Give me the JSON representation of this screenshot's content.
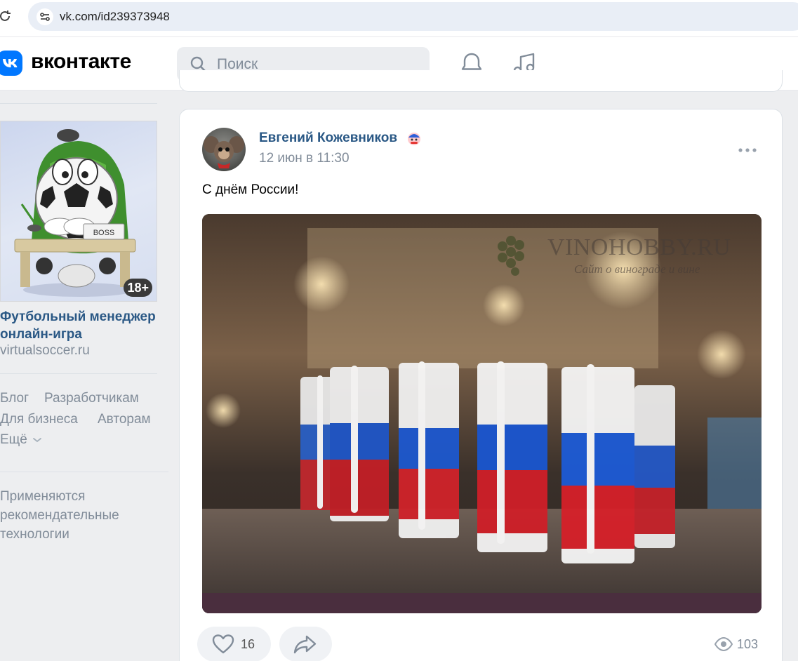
{
  "browser": {
    "url": "vk.com/id239373948"
  },
  "header": {
    "logo_text": "вконтакте",
    "search_placeholder": "Поиск"
  },
  "sidebar": {
    "ad": {
      "age_badge": "18+",
      "title": "Футбольный менеджер онлайн-игра",
      "domain": "virtualsoccer.ru",
      "image_sign": "BOSS"
    },
    "footer_links": {
      "blog": "Блог",
      "developers": "Разработчикам",
      "business": "Для бизнеса",
      "authors": "Авторам",
      "more": "Ещё"
    },
    "recommendations_note": "Применяются рекомендательные технологии"
  },
  "post": {
    "author": "Евгений Кожевников",
    "time": "12 июн в 11:30",
    "text": "С днём России!",
    "photo_watermark_title": "VINOHOBBY.RU",
    "photo_watermark_subtitle": "Сайт о винограде и вине",
    "likes": "16",
    "views": "103"
  },
  "colors": {
    "accent": "#0077ff",
    "link": "#2a5885",
    "secondary_text": "#818c99",
    "page_bg": "#edeef0"
  }
}
